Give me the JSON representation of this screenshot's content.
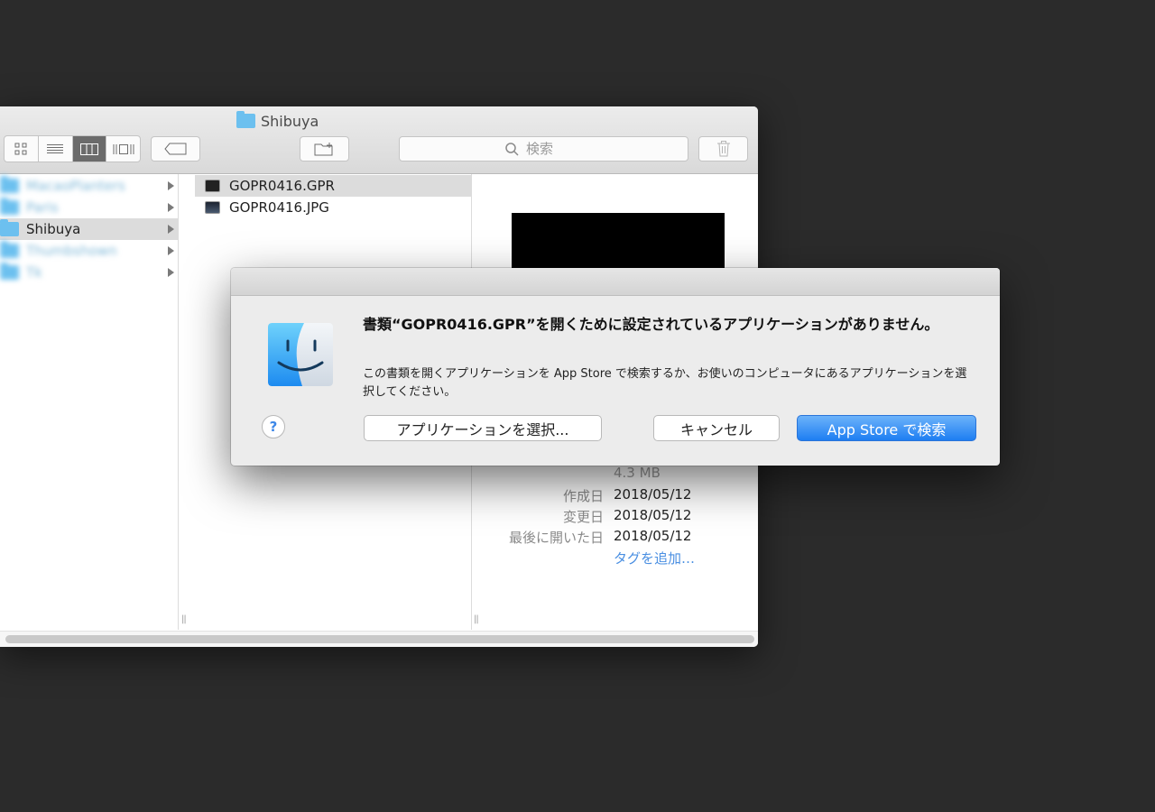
{
  "finder": {
    "title": "Shibuya",
    "search": {
      "placeholder": "検索"
    },
    "sidebar_items": [
      {
        "label": "MacaoPlanters",
        "blurred": true
      },
      {
        "label": "Paris",
        "blurred": true
      },
      {
        "label": "Shibuya",
        "blurred": false,
        "selected": true
      },
      {
        "label": "Thumbshown",
        "blurred": true
      },
      {
        "label": "Tk",
        "blurred": true
      }
    ],
    "files": [
      {
        "name": "GOPR0416.GPR",
        "selected": true
      },
      {
        "name": "GOPR0416.JPG",
        "selected": false
      }
    ],
    "preview": {
      "size": "4.3 MB",
      "created_label": "作成日",
      "created_value": "2018/05/12",
      "modified_label": "変更日",
      "modified_value": "2018/05/12",
      "opened_label": "最後に開いた日",
      "opened_value": "2018/05/12",
      "add_tags": "タグを追加…"
    }
  },
  "dialog": {
    "title": "書類“GOPR0416.GPR”を開くために設定されているアプリケーションがありません。",
    "message": "この書類を開くアプリケーションを App Store で検索するか、お使いのコンピュータにあるアプリケーションを選択してください。",
    "help_label": "?",
    "choose_app_label": "アプリケーションを選択...",
    "cancel_label": "キャンセル",
    "app_store_label": "App Store で検索"
  },
  "colors": {
    "accent": "#1e7ef2",
    "folder": "#6cc0ef",
    "background": "#2b2b2b"
  }
}
